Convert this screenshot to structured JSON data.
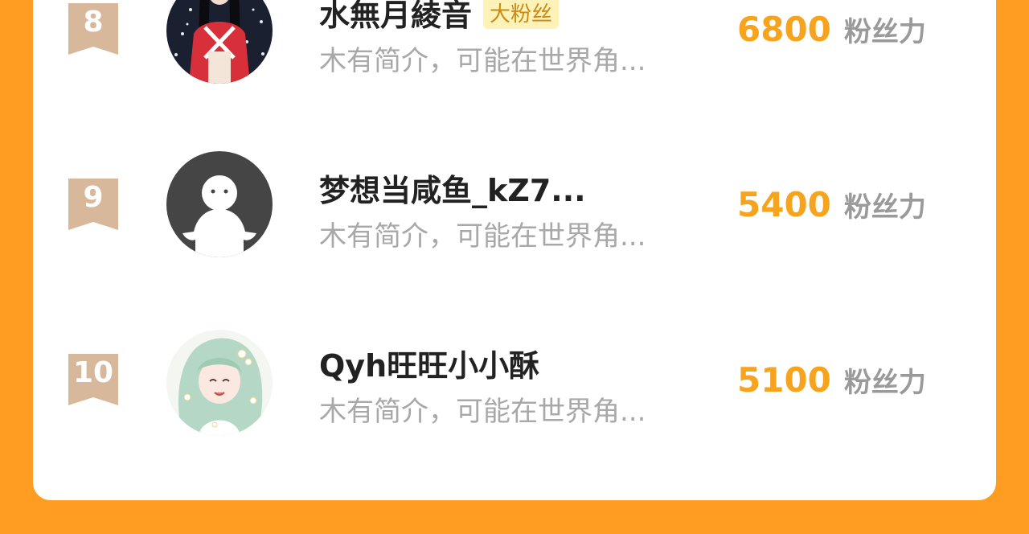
{
  "colors": {
    "page_background": "#ff9d23",
    "card_background": "#ffffff",
    "rank_ribbon": "#d8b89a",
    "score": "#f6a31d",
    "unit": "#9a9a9a",
    "bio": "#a8a8a8",
    "badge_bg": "#fff2b8"
  },
  "fans": [
    {
      "rank": "8",
      "name": "水無月綾音",
      "badge": "大粉丝",
      "bio": "木有简介，可能在世界角...",
      "score": "6800",
      "unit": "粉丝力",
      "avatar": "doll-avatar"
    },
    {
      "rank": "9",
      "name": "梦想当咸鱼_kZ7...",
      "badge": "",
      "bio": "木有简介，可能在世界角...",
      "score": "5400",
      "unit": "粉丝力",
      "avatar": "default-avatar"
    },
    {
      "rank": "10",
      "name": "Qyh旺旺小小酥",
      "badge": "",
      "bio": "木有简介，可能在世界角...",
      "score": "5100",
      "unit": "粉丝力",
      "avatar": "anime-girl-avatar"
    }
  ]
}
